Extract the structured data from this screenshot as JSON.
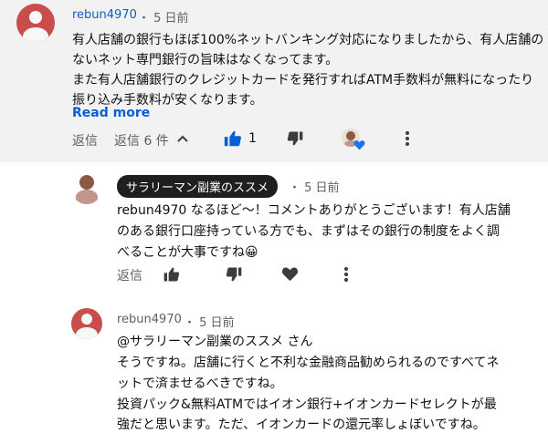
{
  "comment1": {
    "author": "rebun4970",
    "time": "・ 5 日前",
    "lines": [
      "有人店舗の銀行もほぼ100%ネットバンキング対応になりましたから、有人店舗の",
      "ないネット専門銀行の旨味はなくなってます。",
      "また有人店舗銀行のクレジットカードを発行すればATM手数料が無料になったり",
      "振り込み手数料が安くなります。"
    ],
    "read_more": "Read more",
    "reply_label": "返信",
    "replies_label": "返信 6 件",
    "like_count": "1",
    "accent": "#065fd4"
  },
  "reply1": {
    "author_badge": "サラリーマン副業のススメ",
    "time": "・ 5 日前",
    "lines": [
      "rebun4970 なるほど〜！コメントありがとうございます！有人店舗",
      "のある銀行口座持っている方でも、まずはその銀行の制度をよく調",
      "べることが大事ですね😀"
    ],
    "reply_label": "返信"
  },
  "reply2": {
    "author": "rebun4970",
    "time": "・ 5 日前",
    "lines": [
      "@サラリーマン副業のススメ さん",
      "そうですね。店舗に行くと不利な金融商品勧められるのですべてネ",
      "ットで済ませるべきですね。",
      "投資パック&無料ATMではイオン銀行+イオンカードセレクトが最",
      "強だと思います。ただ、イオンカードの還元率しょぼいですね。"
    ]
  },
  "icons": {
    "like": "thumbs-up-icon",
    "dislike": "thumbs-down-icon",
    "collapse": "chevron-up-icon",
    "more": "more-vertical-icon",
    "heart": "heart-icon"
  }
}
